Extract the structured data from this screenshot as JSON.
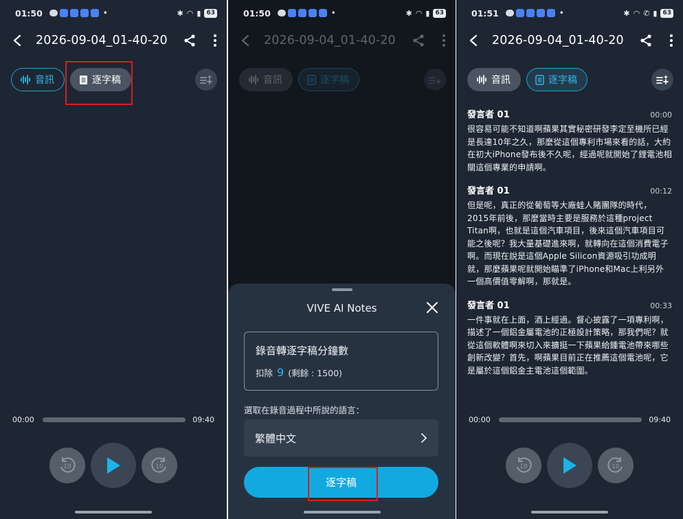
{
  "panel1": {
    "status": {
      "time": "01:50",
      "battery": "63"
    },
    "title": "2026-09-04_01-40-20",
    "tabs": {
      "audio": "音訊",
      "transcript": "逐字稿"
    },
    "player": {
      "start": "00:00",
      "end": "09:40",
      "rewind_label": "10",
      "forward_label": "10"
    }
  },
  "panel2": {
    "status": {
      "time": "01:50",
      "battery": "63"
    },
    "title": "2026-09-04_01-40-20",
    "tabs": {
      "audio": "音訊",
      "transcript": "逐字稿"
    },
    "sheet": {
      "title": "VIVE AI Notes",
      "quota_title": "錄音轉逐字稿分鐘數",
      "deduct_label": "扣除",
      "deduct_value": "9",
      "remaining": "(剩餘 : 1500)",
      "lang_prompt": "選取在錄音過程中所說的語言：",
      "lang_value": "繁體中文",
      "confirm_button": "逐字稿"
    }
  },
  "panel3": {
    "status": {
      "time": "01:51",
      "battery": "63"
    },
    "title": "2026-09-04_01-40-20",
    "tabs": {
      "audio": "音訊",
      "transcript": "逐字稿"
    },
    "segments": [
      {
        "speaker": "發言者 01",
        "time": "00:00",
        "text": "很容易可能不知道啊蘋果其實秘密研發李定至機所已經是長達10年之久，那麼從這個專利市場來看的話，大約在初大iPhone發布後不久呢，經過呢就開始了鋰電池相關這個專業的申請啊。"
      },
      {
        "speaker": "發言者 01",
        "time": "00:12",
        "text": "但是呢，真正的從葡萄等大廠蛙人賭團隊的時代，2015年前後，那麼當時主要是服務於這種project Titan啊，也就是這個汽車項目，後來這個汽車項目可能之後呢？我大量基礎進來啊，就轉向在這個消費電子啊。而現在說是這個Apple Silicon資源吸引功成明就，那麼蘋果呢就開始瞄準了iPhone和Mac上利另外一個高價值零解啊，那就是。"
      },
      {
        "speaker": "發言者 01",
        "time": "00:33",
        "text": "一件事就在上面，酒上經過。督心披露了一項專利啊，描述了一個鋁金屬電池的正極設計策略，那我們呢？就從這個軟體啊來切入來擴挺一下蘋果給鍾電池帶來哪些創新改變？首先，啊蘋果目前正在推薦這個電池呢，它是屬於這個鋁金主電池這個範圍。"
      }
    ],
    "player": {
      "start": "00:00",
      "end": "09:40",
      "rewind_label": "10",
      "forward_label": "10"
    }
  }
}
